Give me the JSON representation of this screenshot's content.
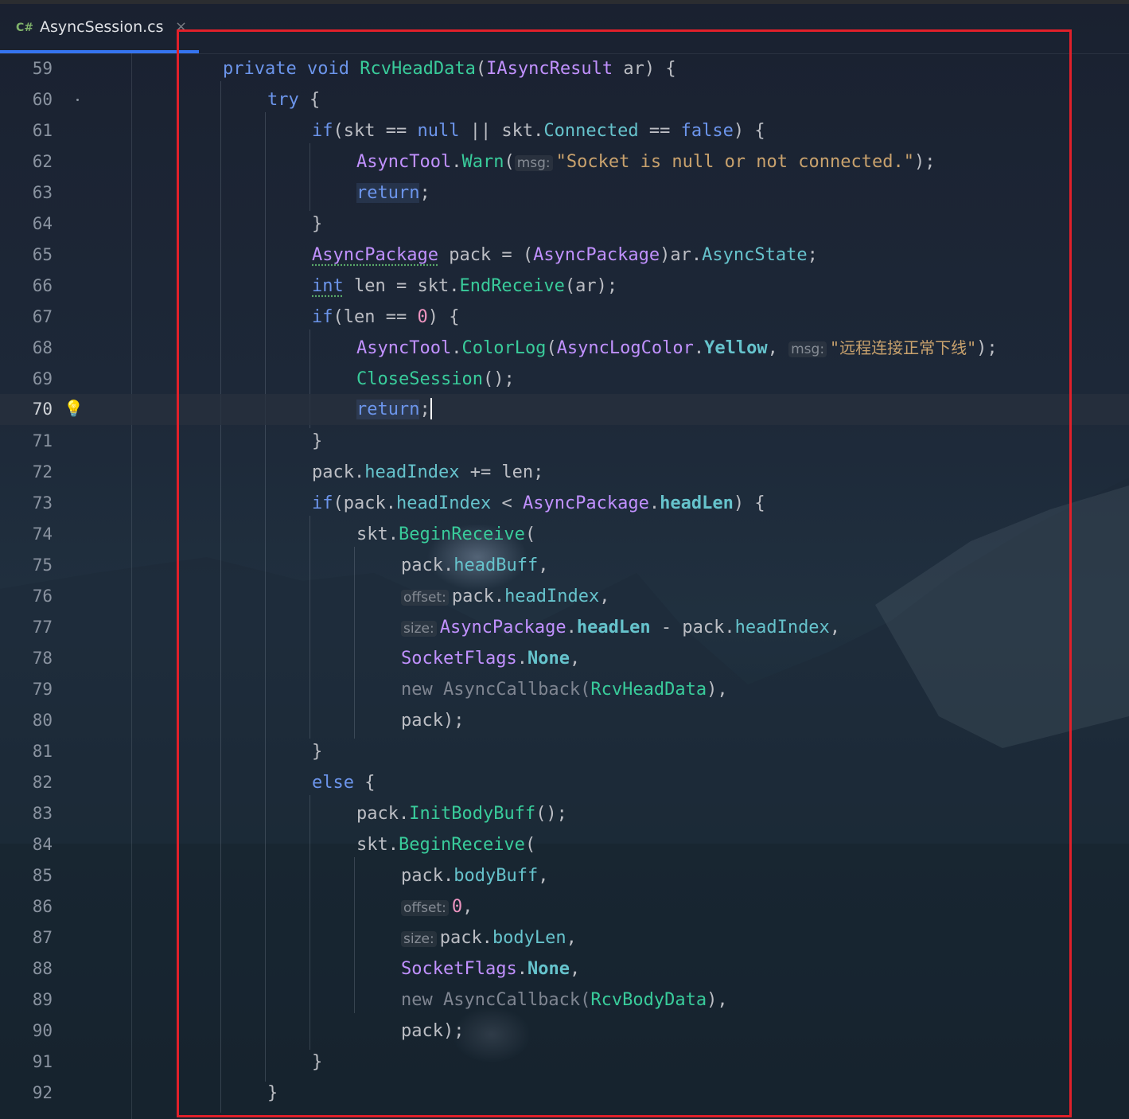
{
  "tab": {
    "icon": "C#",
    "filename": "AsyncSession.cs",
    "close": "×"
  },
  "colors": {
    "keyword": "#6c95eb",
    "type": "#c191ff",
    "method": "#39cc9b",
    "member": "#66c3cc",
    "string": "#c9a26d",
    "number": "#ed94c0",
    "highlight_box": "#e0202a",
    "tab_underline": "#3574f0"
  },
  "gutter": {
    "bulb_icon": "lightbulb-icon",
    "current_line": "70"
  },
  "lines": [
    {
      "num": "59",
      "t": [
        "private ",
        " ",
        " ",
        "(",
        " ar) {"
      ],
      "w": [
        "void",
        "RcvHeadData",
        "IAsyncResult"
      ]
    },
    {
      "num": "60",
      "kw": "try",
      "rest": " {"
    },
    {
      "num": "61",
      "a": "if",
      "b": "(skt == ",
      "c": "null",
      "d": " || skt.",
      "e": "Connected",
      "f": " == ",
      "g": "false",
      "h": ") {"
    },
    {
      "num": "62",
      "a": "AsyncTool",
      "b": ".",
      "c": "Warn",
      "d": "(",
      "hint": "msg:",
      "str": "\"Socket is null or not connected.\"",
      "end": ");"
    },
    {
      "num": "63",
      "kw": "return",
      "rest": ";"
    },
    {
      "num": "64",
      "rest": "}"
    },
    {
      "num": "65",
      "a": "AsyncPackage",
      "b": " pack = (",
      "c": "AsyncPackage",
      "d": ")ar.",
      "e": "AsyncState",
      "f": ";"
    },
    {
      "num": "66",
      "a": "int",
      "b": " len = skt.",
      "c": "EndReceive",
      "d": "(ar);"
    },
    {
      "num": "67",
      "a": "if",
      "b": "(len == ",
      "c": "0",
      "d": ") {"
    },
    {
      "num": "68",
      "a": "AsyncTool",
      "b": ".",
      "c": "ColorLog",
      "d": "(",
      "e": "AsyncLogColor",
      "f": ".",
      "g": "Yellow",
      "h": ", ",
      "hint": "msg:",
      "str": "\"远程连接正常下线\"",
      "end": ");"
    },
    {
      "num": "69",
      "a": "CloseSession",
      "b": "();"
    },
    {
      "num": "70",
      "kw": "return",
      "rest": ";"
    },
    {
      "num": "71",
      "rest": "}"
    },
    {
      "num": "72",
      "a": "pack.",
      "b": "headIndex",
      "c": " += len;"
    },
    {
      "num": "73",
      "a": "if",
      "b": "(pack.",
      "c": "headIndex",
      "d": " < ",
      "e": "AsyncPackage",
      "f": ".",
      "g": "headLen",
      "h": ") {"
    },
    {
      "num": "74",
      "a": "skt.",
      "b": "BeginReceive",
      "c": "("
    },
    {
      "num": "75",
      "a": "pack.",
      "b": "headBuff",
      "c": ","
    },
    {
      "num": "76",
      "hint": "offset:",
      "a": "pack.",
      "b": "headIndex",
      "c": ","
    },
    {
      "num": "77",
      "hint": "size:",
      "a": "AsyncPackage",
      "b": ".",
      "c": "headLen",
      "d": " - pack.",
      "e": "headIndex",
      "f": ","
    },
    {
      "num": "78",
      "a": "SocketFlags",
      "b": ".",
      "c": "None",
      "d": ","
    },
    {
      "num": "79",
      "a": "new AsyncCallback(",
      "b": "RcvHeadData",
      "c": "),"
    },
    {
      "num": "80",
      "a": "pack);"
    },
    {
      "num": "81",
      "rest": "}"
    },
    {
      "num": "82",
      "kw": "else",
      "rest": " {"
    },
    {
      "num": "83",
      "a": "pack.",
      "b": "InitBodyBuff",
      "c": "();"
    },
    {
      "num": "84",
      "a": "skt.",
      "b": "BeginReceive",
      "c": "("
    },
    {
      "num": "85",
      "a": "pack.",
      "b": "bodyBuff",
      "c": ","
    },
    {
      "num": "86",
      "hint": "offset:",
      "a": "0",
      "b": ","
    },
    {
      "num": "87",
      "hint": "size:",
      "a": "pack.",
      "b": "bodyLen",
      "c": ","
    },
    {
      "num": "88",
      "a": "SocketFlags",
      "b": ".",
      "c": "None",
      "d": ","
    },
    {
      "num": "89",
      "a": "new AsyncCallback(",
      "b": "RcvBodyData",
      "c": "),"
    },
    {
      "num": "90",
      "a": "pack);"
    },
    {
      "num": "91",
      "rest": "}"
    },
    {
      "num": "92",
      "rest": "}"
    }
  ]
}
